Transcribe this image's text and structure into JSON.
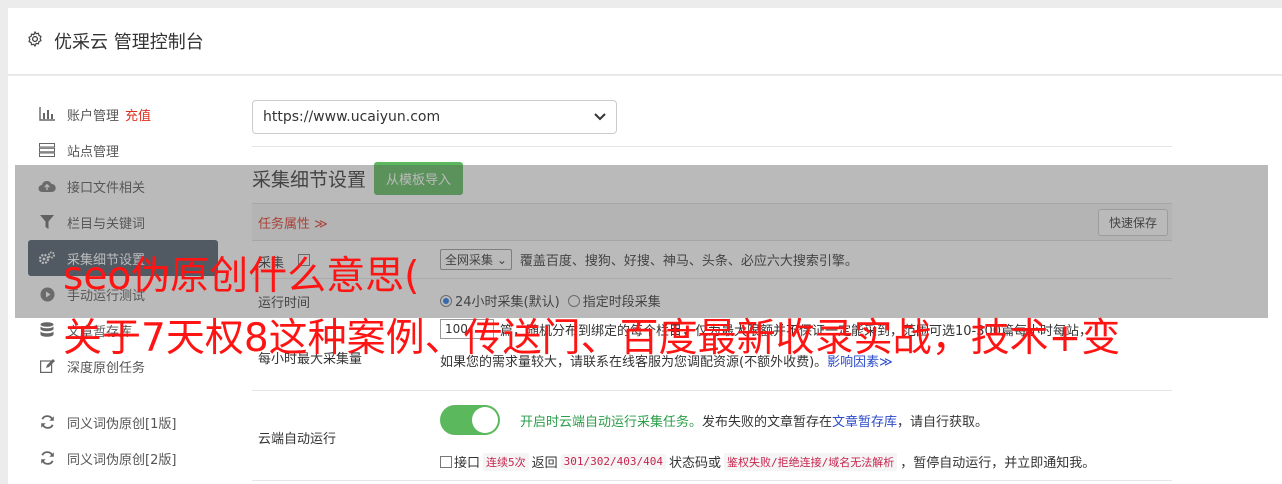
{
  "header": {
    "title": "优采云 管理控制台"
  },
  "sidebar": {
    "items": [
      {
        "label": "账户管理",
        "icon": "bar-chart-icon",
        "badge": "充值"
      },
      {
        "label": "站点管理",
        "icon": "server-icon"
      },
      {
        "label": "接口文件相关",
        "icon": "cloud-upload-icon"
      },
      {
        "label": "栏目与关键词",
        "icon": "filter-icon"
      },
      {
        "label": "采集细节设置",
        "icon": "gears-icon",
        "active": true
      },
      {
        "label": "手动运行测试",
        "icon": "play-circle-icon"
      },
      {
        "label": "文章暂存库",
        "icon": "database-icon"
      },
      {
        "label": "深度原创任务",
        "icon": "edit-icon"
      }
    ],
    "items2": [
      {
        "label": "同义词伪原创[1版]",
        "icon": "refresh-icon"
      },
      {
        "label": "同义词伪原创[2版]",
        "icon": "refresh-icon"
      }
    ]
  },
  "content": {
    "site_select": "https://www.ucaiyun.com",
    "section_title": "采集细节设置",
    "import_button": "从模板导入",
    "task_tab": "任务属性 ≫",
    "save_button": "快速保存",
    "rows": {
      "collect": {
        "label": "采集",
        "select": "全网采集",
        "desc": "覆盖百度、搜狗、好搜、神马、头条、必应六大搜索引擎。"
      },
      "runtime": {
        "label": "运行时间",
        "opt1": "24小时采集(默认)",
        "opt2": "指定时段采集"
      },
      "max": {
        "label": "每小时最大采集量",
        "value": "100",
        "line1": "篇，随机分布到绑定的每个栏目，仅为最大限额并不保证一定能采到，范围可选10-300篇每小时每站，",
        "line2": "如果您的需求量较大，请联系在线客服为您调配资源(不额外收费)。",
        "link": "影响因素≫"
      },
      "cloud": {
        "label": "云端自动运行",
        "green_text": "开启时云端自动运行采集任务。",
        "text2": "发布失败的文章暂存在",
        "link": "文章暂存库",
        "text3": "，请自行获取。",
        "cb_label": "接口",
        "code1": "连续5次",
        "t1": "返回",
        "code2": "301/302/403/404",
        "t2": "状态码或",
        "code3": "鉴权失败/拒绝连接/域名无法解析",
        "t3": "，暂停自动运行，并立即通知我。"
      }
    }
  },
  "overlay": {
    "line1": "seo伪原创什么意思(",
    "line2": "关于7天权8这种案例、传送门、百度最新收录实战，技术+变"
  },
  "colors": {
    "accent_green": "#5cb85c",
    "active_nav": "#4a5a6a",
    "red": "#e0301e",
    "link": "#2a4ac8"
  }
}
